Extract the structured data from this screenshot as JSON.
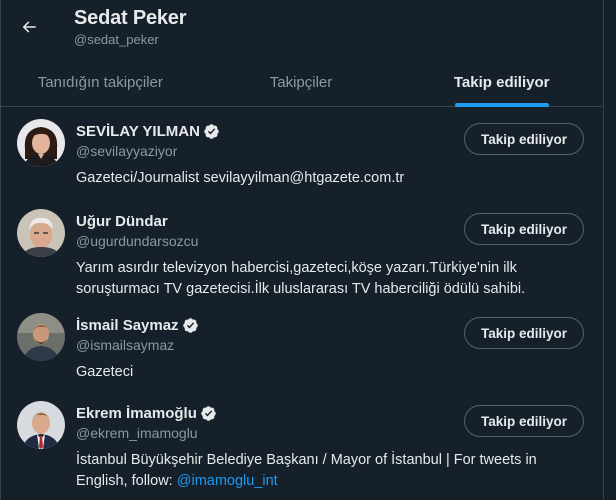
{
  "header": {
    "title": "Sedat Peker",
    "handle": "@sedat_peker"
  },
  "tabs": [
    {
      "label": "Tanıdığın takipçiler",
      "active": false
    },
    {
      "label": "Takipçiler",
      "active": false
    },
    {
      "label": "Takip ediliyor",
      "active": true
    }
  ],
  "colors": {
    "background": "#15202b",
    "accent": "#1d9bf0",
    "text_primary": "#e7e9ea",
    "text_secondary": "#8b98a5",
    "border": "#38444d"
  },
  "users": [
    {
      "name": "SEVİLAY YILMAN",
      "verified": true,
      "handle": "@sevilayyaziyor",
      "bio": "Gazeteci/Journalist sevilayyilman@htgazete.com.tr",
      "button": "Takip ediliyor"
    },
    {
      "name": "Uğur Dündar",
      "verified": false,
      "handle": "@ugurdundarsozcu",
      "bio": "Yarım asırdır televizyon habercisi,gazeteci,köşe yazarı.Türkiye'nin ilk soruşturmacı TV gazetecisi.İlk uluslararası TV haberciliği ödülü sahibi.",
      "button": "Takip ediliyor"
    },
    {
      "name": "İsmail Saymaz",
      "verified": true,
      "handle": "@ismailsaymaz",
      "bio": "Gazeteci",
      "button": "Takip ediliyor"
    },
    {
      "name": "Ekrem İmamoğlu",
      "verified": true,
      "handle": "@ekrem_imamoglu",
      "bio": "İstanbul Büyükşehir Belediye Başkanı / Mayor of İstanbul | For tweets in English, follow: ",
      "bio_mention": "@imamoglu_int",
      "button": "Takip ediliyor"
    }
  ],
  "icons": {
    "back": "arrow-left-icon",
    "verified": "verified-badge-icon"
  }
}
